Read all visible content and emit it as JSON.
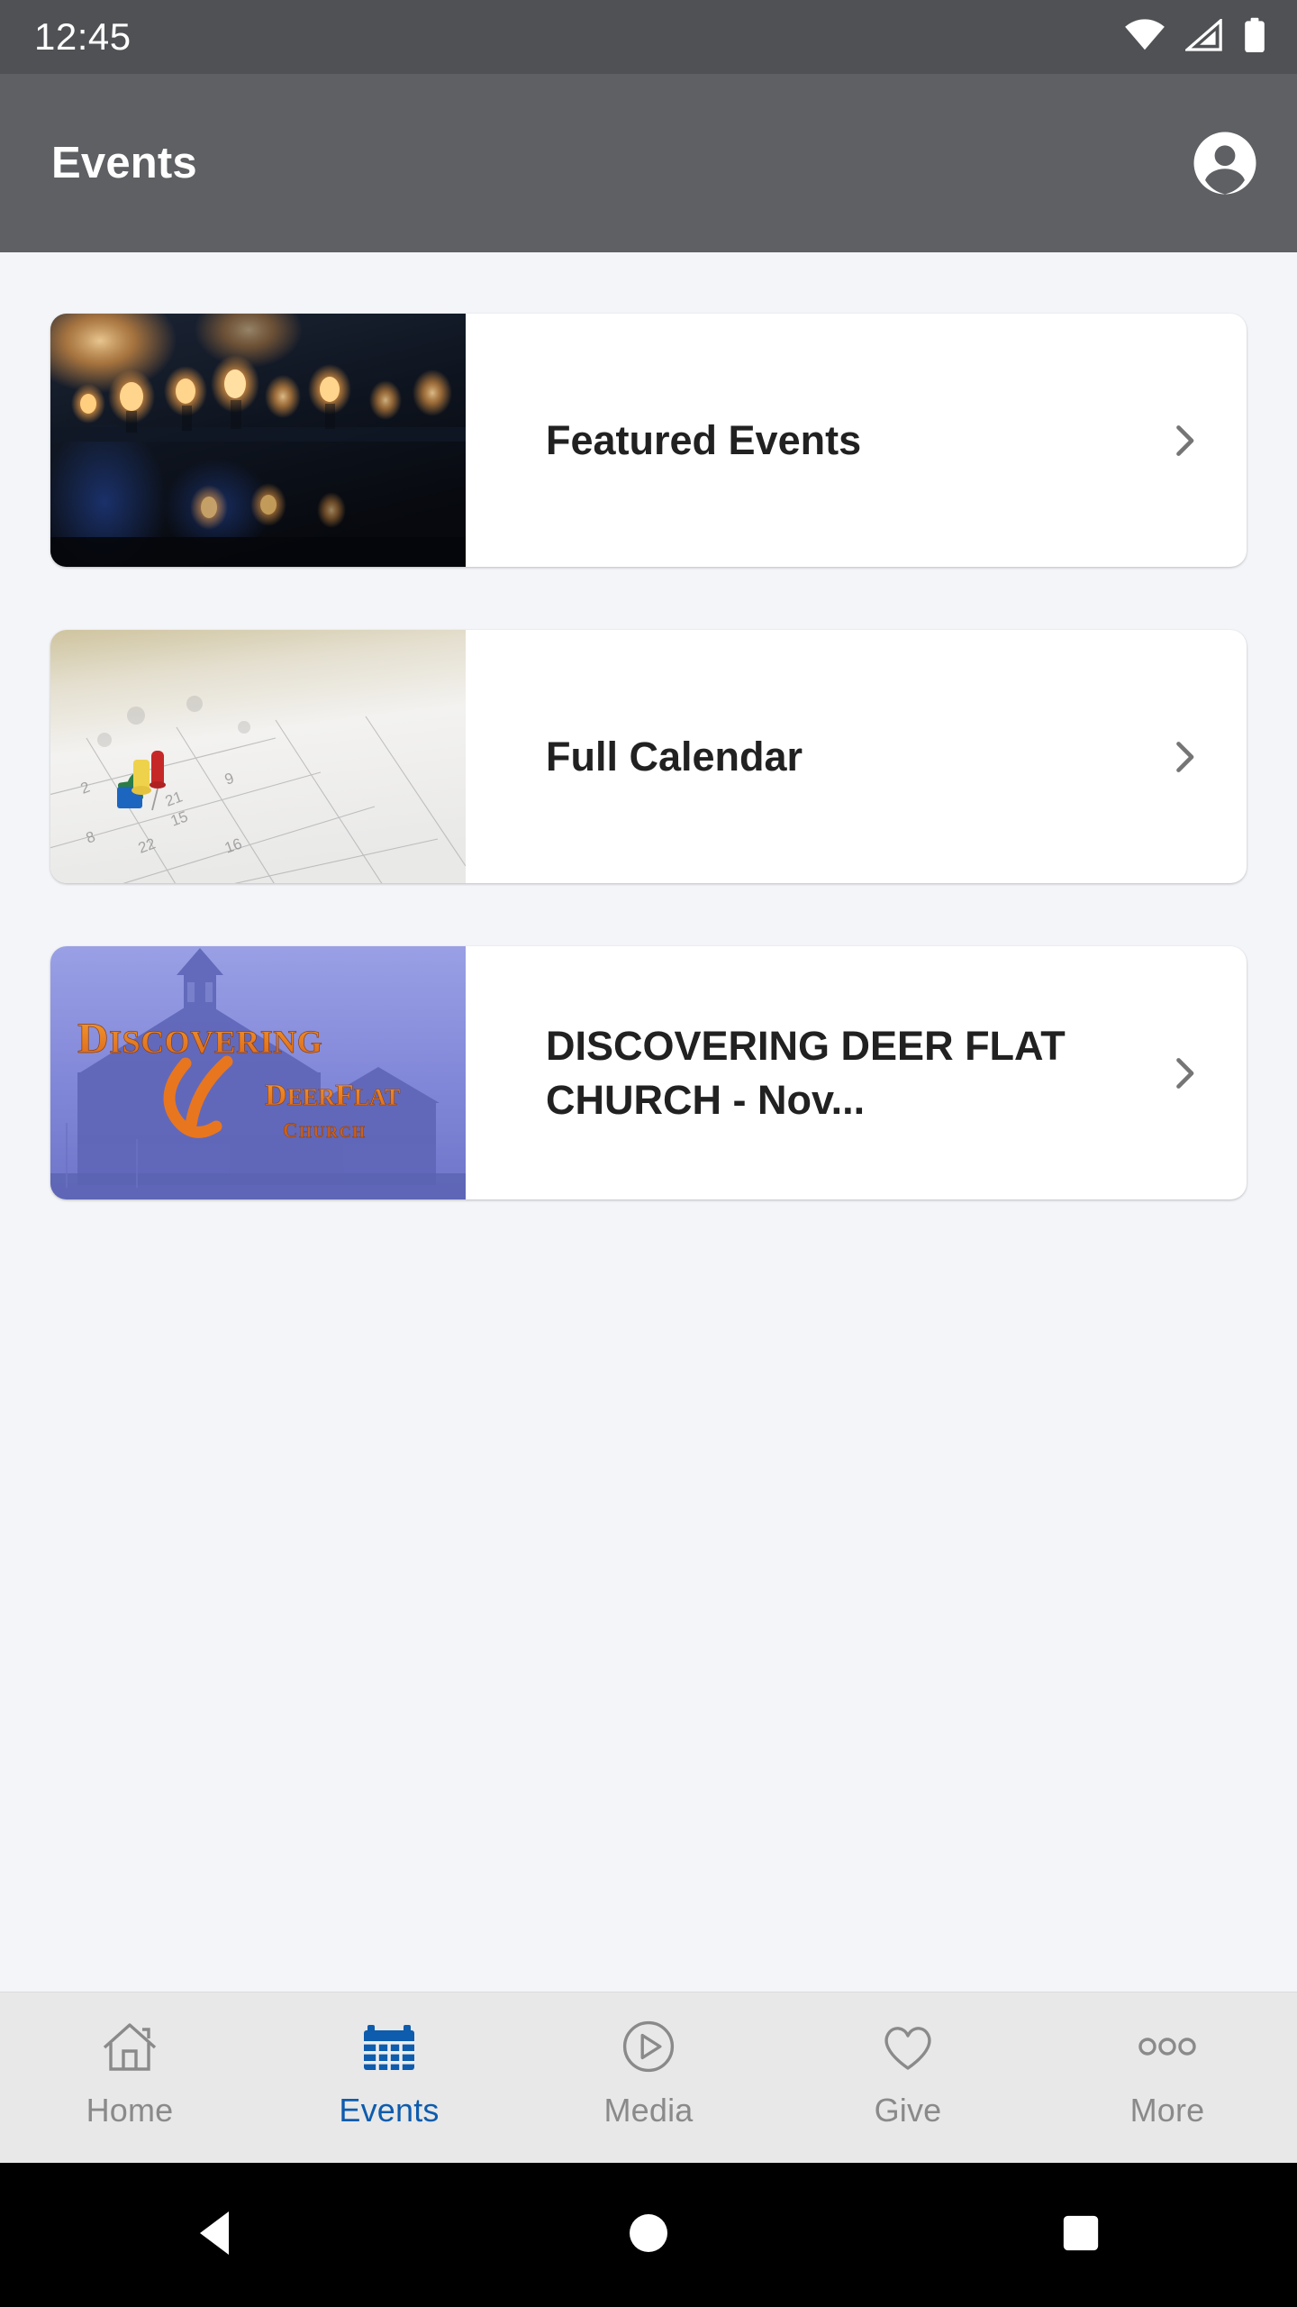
{
  "status_bar": {
    "time": "12:45",
    "icons": [
      "wifi-icon",
      "cellular-signal-icon",
      "battery-icon"
    ],
    "background": "#4F5154"
  },
  "app_bar": {
    "title": "Events",
    "account_icon": "account-circle-icon",
    "background": "#5E6063"
  },
  "content": {
    "background": "#F4F5F9",
    "cards": [
      {
        "title": "Featured Events",
        "thumbnail": "string-lights-bokeh-photo",
        "chevron": "chevron-right-icon"
      },
      {
        "title": "Full Calendar",
        "thumbnail": "calendar-with-pushpins-photo",
        "chevron": "chevron-right-icon"
      },
      {
        "title": "DISCOVERING DEER FLAT CHURCH - Nov...",
        "thumbnail": "discovering-deer-flat-church-logo",
        "thumbnail_text": {
          "line1": "DISCOVERING",
          "line2": "DeerFlat",
          "line3": "CHURCH"
        },
        "chevron": "chevron-right-icon"
      }
    ]
  },
  "tab_bar": {
    "background": "#E8E8E8",
    "active_color": "#0D5CAD",
    "inactive_color": "#8A8A8A",
    "tabs": [
      {
        "label": "Home",
        "icon": "home-icon",
        "active": false
      },
      {
        "label": "Events",
        "icon": "calendar-icon",
        "active": true
      },
      {
        "label": "Media",
        "icon": "play-circle-icon",
        "active": false
      },
      {
        "label": "Give",
        "icon": "heart-icon",
        "active": false
      },
      {
        "label": "More",
        "icon": "more-dots-icon",
        "active": false
      }
    ]
  },
  "android_nav": {
    "background": "#000000",
    "buttons": [
      {
        "name": "back-button",
        "icon": "triangle-left-icon"
      },
      {
        "name": "home-button",
        "icon": "circle-icon"
      },
      {
        "name": "recents-button",
        "icon": "square-icon"
      }
    ]
  }
}
